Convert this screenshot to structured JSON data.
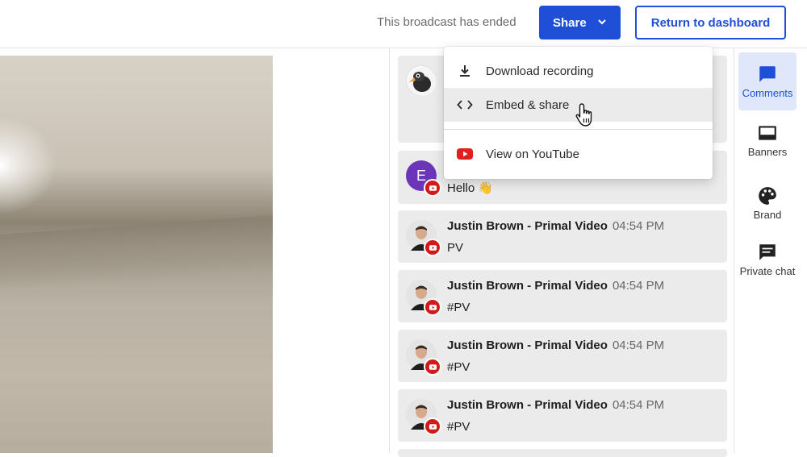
{
  "topbar": {
    "status": "This broadcast has ended",
    "share_label": "Share",
    "return_label": "Return to dashboard"
  },
  "share_menu": {
    "items": [
      {
        "label": "Download recording",
        "icon": "download-icon"
      },
      {
        "label": "Embed & share",
        "icon": "code-icon"
      },
      {
        "label": "View on YouTube",
        "icon": "youtube-icon"
      }
    ]
  },
  "comments": [
    {
      "author": "",
      "time": "",
      "text": ""
    },
    {
      "author": "",
      "time": "",
      "text": "Hello 👋",
      "avatar_letter": "E"
    },
    {
      "author": "Justin Brown - Primal Video",
      "time": "04:54 PM",
      "text": "PV"
    },
    {
      "author": "Justin Brown - Primal Video",
      "time": "04:54 PM",
      "text": "#PV"
    },
    {
      "author": "Justin Brown - Primal Video",
      "time": "04:54 PM",
      "text": "#PV"
    },
    {
      "author": "Justin Brown - Primal Video",
      "time": "04:54 PM",
      "text": "#PV"
    }
  ],
  "rail": {
    "items": [
      {
        "label": "Comments",
        "icon": "comment-icon"
      },
      {
        "label": "Banners",
        "icon": "banner-icon"
      },
      {
        "label": "Brand",
        "icon": "palette-icon"
      },
      {
        "label": "Private chat",
        "icon": "chat-icon"
      }
    ]
  },
  "colors": {
    "accent": "#1f4fd6",
    "youtube": "#d11b1b",
    "card": "#ebebeb"
  }
}
